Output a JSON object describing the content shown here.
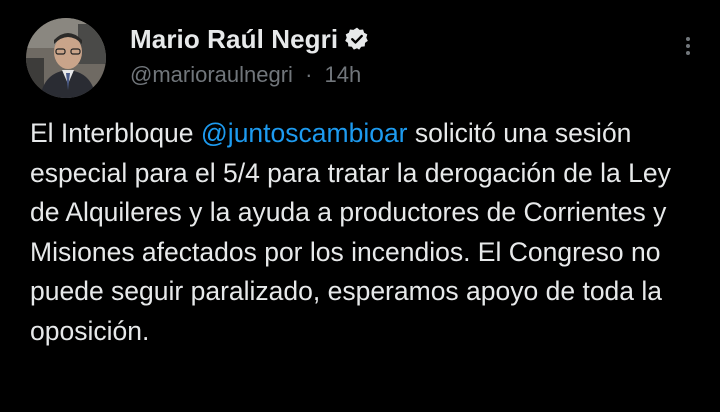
{
  "author": {
    "display_name": "Mario Raúl Negri",
    "handle": "@marioraulnegri",
    "separator": "·",
    "time": "14h",
    "verified_icon": "verified-badge-icon"
  },
  "menu": {
    "icon": "more-options-icon"
  },
  "tweet": {
    "text_before": "El Interbloque ",
    "mention": "@juntoscambioar",
    "text_after": " solicitó una sesión especial para el 5/4 para tratar la derogación de la Ley de Alquileres y la ayuda a productores de Corrientes y Misiones afectados por los incendios. El Congreso no puede seguir paralizado, esperamos apoyo de toda la oposición."
  },
  "colors": {
    "background": "#000000",
    "text": "#e7e9ea",
    "secondary": "#71767b",
    "link": "#1d9bf0"
  }
}
